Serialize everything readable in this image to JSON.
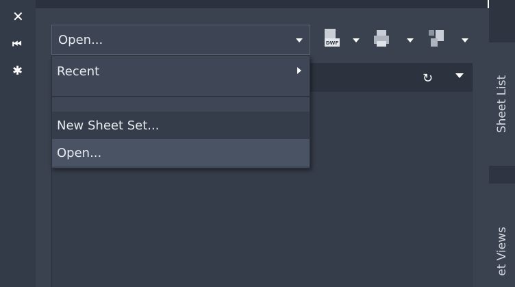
{
  "side_toolbar": {
    "close_icon": "✕",
    "auto_hide_icon": "⏮",
    "settings_icon": "✱"
  },
  "combo": {
    "value": "Open..."
  },
  "toolbar": {
    "icons": [
      "publish-dwf-icon",
      "print-icon",
      "sheet-icon"
    ],
    "dwf_label": "DWF"
  },
  "header": {
    "refresh_icon": "↻"
  },
  "menu": {
    "recent": "Recent",
    "new_sheet_set": "New Sheet Set...",
    "open": "Open..."
  },
  "tabs": {
    "sheet_list": "Sheet List",
    "sheet_views": "et Views"
  },
  "colors": {
    "panel_bg": "#3a4250",
    "menu_bg": "#3f4757",
    "highlight": "#4a5364",
    "strip_bg": "#333b48"
  }
}
